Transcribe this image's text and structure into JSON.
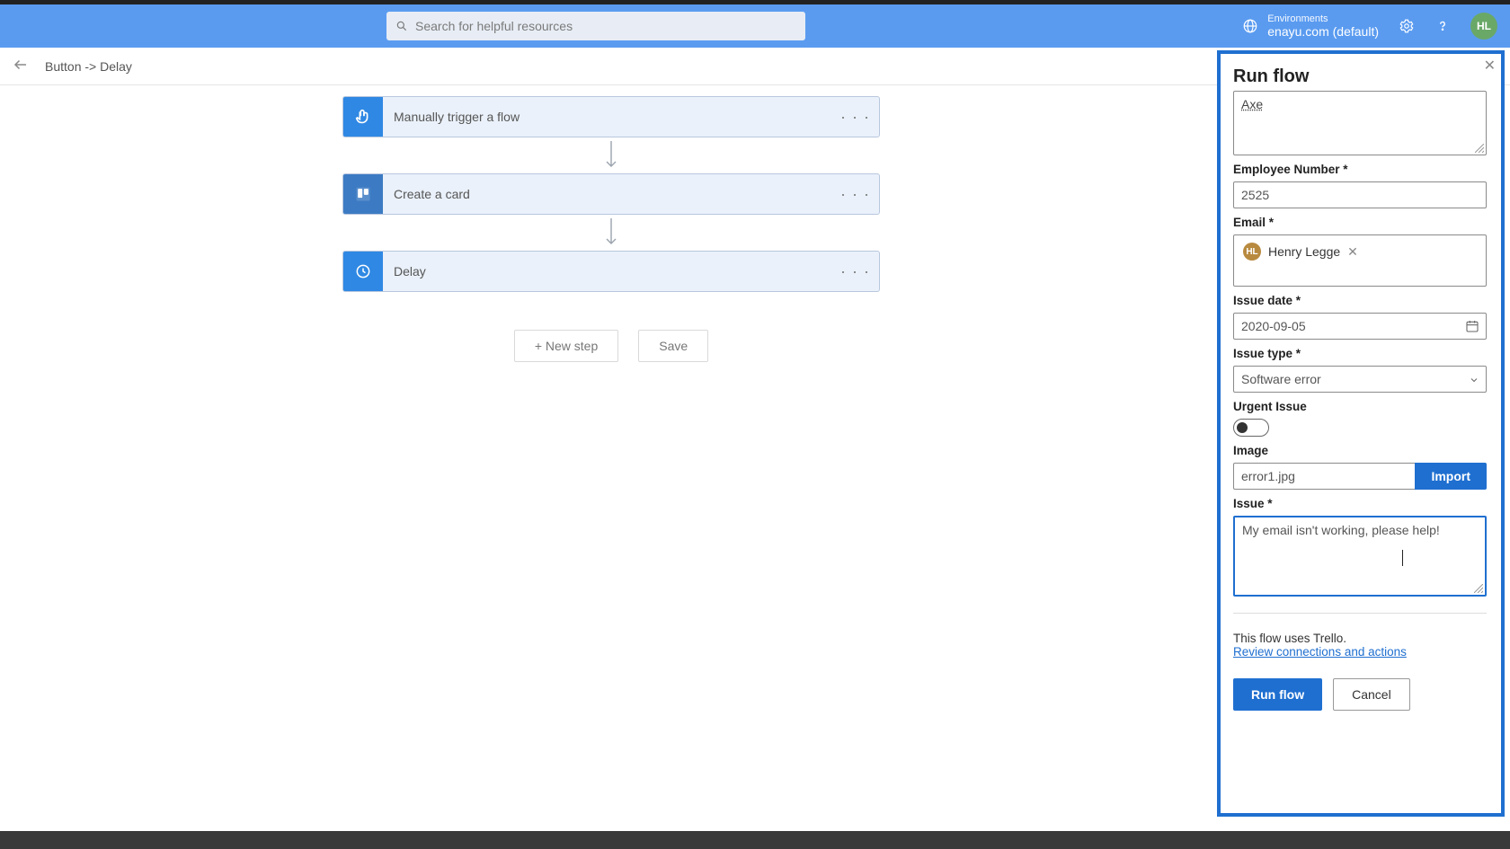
{
  "header": {
    "search_placeholder": "Search for helpful resources",
    "env_label": "Environments",
    "env_name": "enayu.com (default)",
    "avatar_initials": "HL"
  },
  "subbar": {
    "breadcrumb": "Button -> Delay"
  },
  "flow": {
    "nodes": [
      {
        "title": "Manually trigger a flow",
        "icon": "tap"
      },
      {
        "title": "Create a card",
        "icon": "trello"
      },
      {
        "title": "Delay",
        "icon": "clock"
      }
    ],
    "new_step_label": "+ New step",
    "save_label": "Save"
  },
  "panel": {
    "title": "Run flow",
    "top_textarea_value": "Axe",
    "fields": {
      "employee_number": {
        "label": "Employee Number *",
        "value": "2525"
      },
      "email": {
        "label": "Email *",
        "person_name": "Henry Legge",
        "person_initials": "HL"
      },
      "issue_date": {
        "label": "Issue date *",
        "value": "2020-09-05"
      },
      "issue_type": {
        "label": "Issue type *",
        "value": "Software error"
      },
      "urgent": {
        "label": "Urgent Issue",
        "on": false
      },
      "image": {
        "label": "Image",
        "filename": "error1.jpg",
        "import_label": "Import"
      },
      "issue": {
        "label": "Issue *",
        "value": "My email isn't working, please help!"
      }
    },
    "footer_text": "This flow uses Trello.",
    "footer_link": "Review connections and actions",
    "run_label": "Run flow",
    "cancel_label": "Cancel"
  }
}
